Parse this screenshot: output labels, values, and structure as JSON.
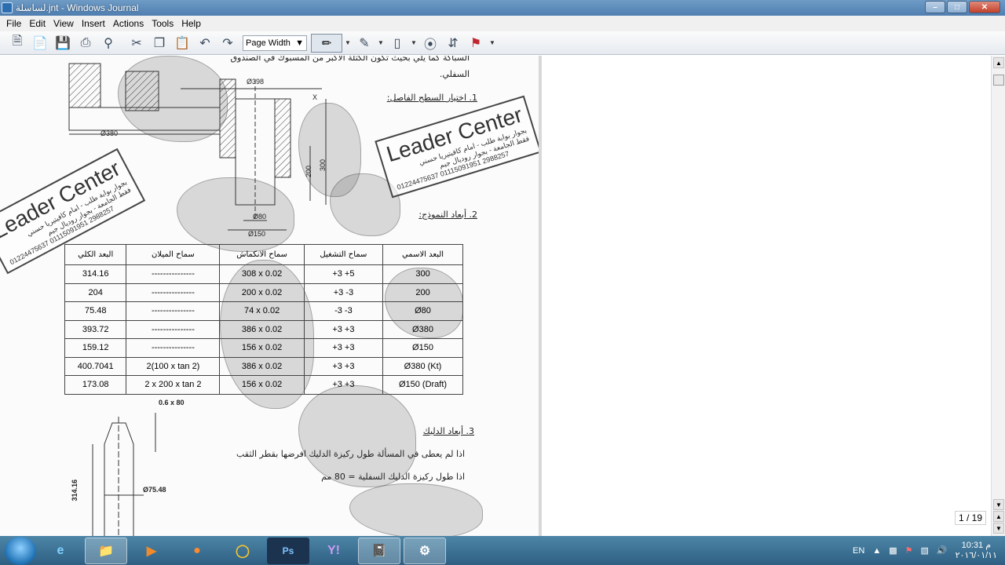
{
  "window": {
    "title": "لساسلة.jnt - Windows Journal",
    "controls": [
      "–",
      "□",
      "✕"
    ]
  },
  "menu": [
    "File",
    "Edit",
    "View",
    "Insert",
    "Actions",
    "Tools",
    "Help"
  ],
  "toolbar": {
    "zoom_value": "Page Width",
    "icons": [
      "new-note-icon",
      "new-page-icon",
      "save-icon",
      "print-icon",
      "find-icon",
      "cut-icon",
      "copy-icon",
      "paste-icon",
      "undo-icon",
      "redo-icon",
      "pen-icon",
      "highlighter-icon",
      "eraser-icon",
      "lasso-icon",
      "insert-space-icon",
      "flag-icon"
    ]
  },
  "document": {
    "heading_line1": "السباكة كما يلي بحيث تكون الكتلة الأكبر من المسبوك في الصندوق",
    "heading_line2": "السفلي.",
    "item1": "1.  اختيار السطح الفاصل:",
    "item2": "2.  أبعاد النموذج:",
    "item3": "3.  أبعاد الدليك",
    "line3a": "اذا لم يعطى في المسألة طول ركيزة الدليك افرضها بقطر الثقب",
    "line3b": "اذا طول ركيزة الدليك السفلية = 80 مم",
    "dims": {
      "d380": "Ø380",
      "d398": "Ø398",
      "d80": "Ø80",
      "d150": "Ø150",
      "h300": "300",
      "h200": "200",
      "x_mark": "X",
      "chamfer": "0.6 x 80",
      "h314": "314.16",
      "d7548": "Ø75.48"
    },
    "stamp": {
      "brand": "Leader Center",
      "line1": "بجوار بوابة طلب - امام كافيتيريا حسني",
      "line2": "فقط الجامعة - بجوار روديال جيم",
      "phones": "01224475637  01115091951  2988257"
    },
    "table": {
      "headers": [
        "البعد الكلي",
        "سماح الميلان",
        "سماح الانكماش",
        "سماح التشغيل",
        "البعد الاسمي"
      ],
      "rows": [
        [
          "314.16",
          "---------------",
          "308 x 0.02",
          "+3 +5",
          "300"
        ],
        [
          "204",
          "---------------",
          "200 x 0.02",
          "+3 -3",
          "200"
        ],
        [
          "75.48",
          "---------------",
          "74 x 0.02",
          "-3 -3",
          "Ø80"
        ],
        [
          "393.72",
          "---------------",
          "386 x 0.02",
          "+3 +3",
          "Ø380"
        ],
        [
          "159.12",
          "---------------",
          "156 x 0.02",
          "+3 +3",
          "Ø150"
        ],
        [
          "400.7041",
          "2(100 x tan 2)",
          "386 x 0.02",
          "+3 +3",
          "Ø380 (Kt)"
        ],
        [
          "173.08",
          "2 x 200 x tan 2",
          "156 x 0.02",
          "+3 +3",
          "Ø150 (Draft)"
        ]
      ]
    }
  },
  "page_indicator": "1 / 19",
  "taskbar": {
    "apps": [
      "ie-icon",
      "explorer-icon",
      "media-player-icon",
      "firefox-icon",
      "chrome-icon",
      "photoshop-icon",
      "yahoo-messenger-icon",
      "journal-icon",
      "app-icon"
    ],
    "language": "EN",
    "time": "10:31 م",
    "date": "٢٠١٦/٠١/١١"
  }
}
